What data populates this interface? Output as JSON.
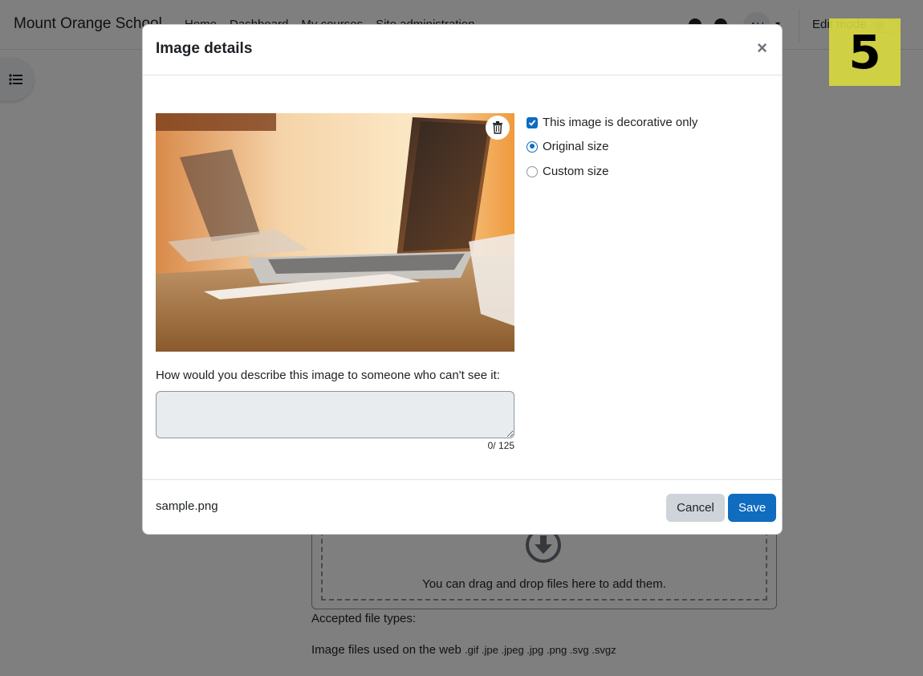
{
  "navbar": {
    "site_name": "Mount Orange School",
    "links": [
      "Home",
      "Dashboard",
      "My courses",
      "Site administration"
    ],
    "avatar_initials": "AU",
    "edit_mode_label": "Edit mode"
  },
  "step_badge": "5",
  "page": {
    "drop_text": "You can drag and drop files here to add them.",
    "accepted_label": "Accepted file types:",
    "filetypes_label": "Image files used on the web",
    "filetypes_ext": ".gif .jpe .jpeg .jpg .png .svg .svgz"
  },
  "modal": {
    "title": "Image details",
    "close_glyph": "×",
    "options": {
      "decorative_label": "This image is decorative only",
      "decorative_checked": true,
      "original_size_label": "Original size",
      "custom_size_label": "Custom size",
      "selected_size": "Original size"
    },
    "alt_label": "How would you describe this image to someone who can't see it:",
    "alt_value": "",
    "counter": "0/ 125",
    "filename": "sample.png",
    "cancel_label": "Cancel",
    "save_label": "Save"
  },
  "colors": {
    "primary": "#0f6cbf",
    "secondary_button": "#ced4da",
    "badge": "#d6d63c"
  }
}
